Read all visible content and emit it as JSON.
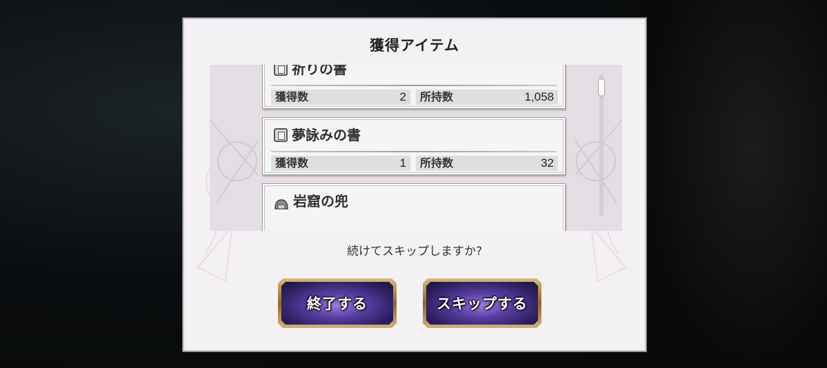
{
  "dialog": {
    "title": "獲得アイテム",
    "question": "続けてスキップしますか?",
    "buttons": {
      "end_label": "終了する",
      "skip_label": "スキップする"
    }
  },
  "items": [
    {
      "name": "祈りの書",
      "icon": "book-icon",
      "obtained_label": "獲得数",
      "obtained": "2",
      "owned_label": "所持数",
      "owned": "1,058"
    },
    {
      "name": "夢詠みの書",
      "icon": "book-icon",
      "obtained_label": "獲得数",
      "obtained": "1",
      "owned_label": "所持数",
      "owned": "32"
    },
    {
      "name": "岩窟の兜",
      "icon": "helmet-icon"
    }
  ],
  "colors": {
    "dialog_bg": "#f4f1f5",
    "button_gold": "#c9a660",
    "button_purple": "#5a3fa6"
  }
}
